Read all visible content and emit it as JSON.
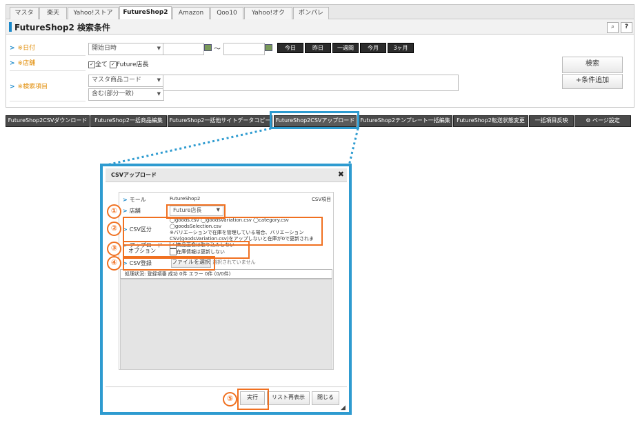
{
  "tabs": [
    {
      "label": "マスタ"
    },
    {
      "label": "楽天"
    },
    {
      "label": "Yahoo!ストア"
    },
    {
      "label": "FutureShop2"
    },
    {
      "label": "Amazon"
    },
    {
      "label": "Qoo10"
    },
    {
      "label": "Yahoo!オク"
    },
    {
      "label": "ポンパレ"
    }
  ],
  "header": {
    "title": "FutureShop2 検索条件",
    "search_icon": "search-icon",
    "help_label": "?"
  },
  "form": {
    "date_label": "※日付",
    "date_select": "開始日時",
    "date_sep": "～",
    "date_buttons": [
      "今日",
      "昨日",
      "一週間",
      "今月",
      "3ヶ月"
    ],
    "shop_label": "※店舗",
    "shop_all": "全て",
    "shop_future": "Future店長",
    "item_label": "※検索項目",
    "item_select1": "マスタ商品コード",
    "item_select2": "含む(部分一致)",
    "search_btn": "検索",
    "add_cond_btn": "+条件追加"
  },
  "toolbar": [
    {
      "label": "FutureShop2CSVダウンロード"
    },
    {
      "label": "FutureShop2一括商品編集"
    },
    {
      "label": "FutureShop2一括他サイトデータコピー"
    },
    {
      "label": "FutureShop2CSVアップロード"
    },
    {
      "label": "FutureShop2テンプレート一括編集"
    },
    {
      "label": "FutureShop2転送状態変更"
    },
    {
      "label": "一括項目反映"
    },
    {
      "label": "ページ設定"
    }
  ],
  "dialog": {
    "title": "CSVアップロード",
    "close": "✖",
    "mall_label": "モール",
    "mall_value": "FutureShop2",
    "csv_item": "CSV項目",
    "shop_label": "店舗",
    "shop_value": "Future店長",
    "csvtype_label": "CSV区分",
    "csv_options": [
      "goods.csv",
      "goodsVariation.csv",
      "category.csv",
      "goodsSelection.csv"
    ],
    "csv_note1": "※バリエーションで在庫を管理している場合、バリエーション",
    "csv_note2": "CSV(goodsVariation.csv)をアップしないと在庫が0で更新されます。",
    "upload_label1": "アップロード",
    "upload_label2": "オプション",
    "opt1": "商品画像は取り込みしない",
    "opt2": "在庫情報は更新しない",
    "reg_label": "CSV登録",
    "file_btn": "ファイルを選択",
    "file_status": "選択されていません",
    "status_text": "処理状況: 登録項番 成功 0件 エラー 0件 (0/0件)",
    "run_btn": "実行",
    "reload_btn": "リスト再表示",
    "close_btn": "閉じる"
  },
  "markers": [
    "①",
    "②",
    "③",
    "④",
    "⑤"
  ]
}
